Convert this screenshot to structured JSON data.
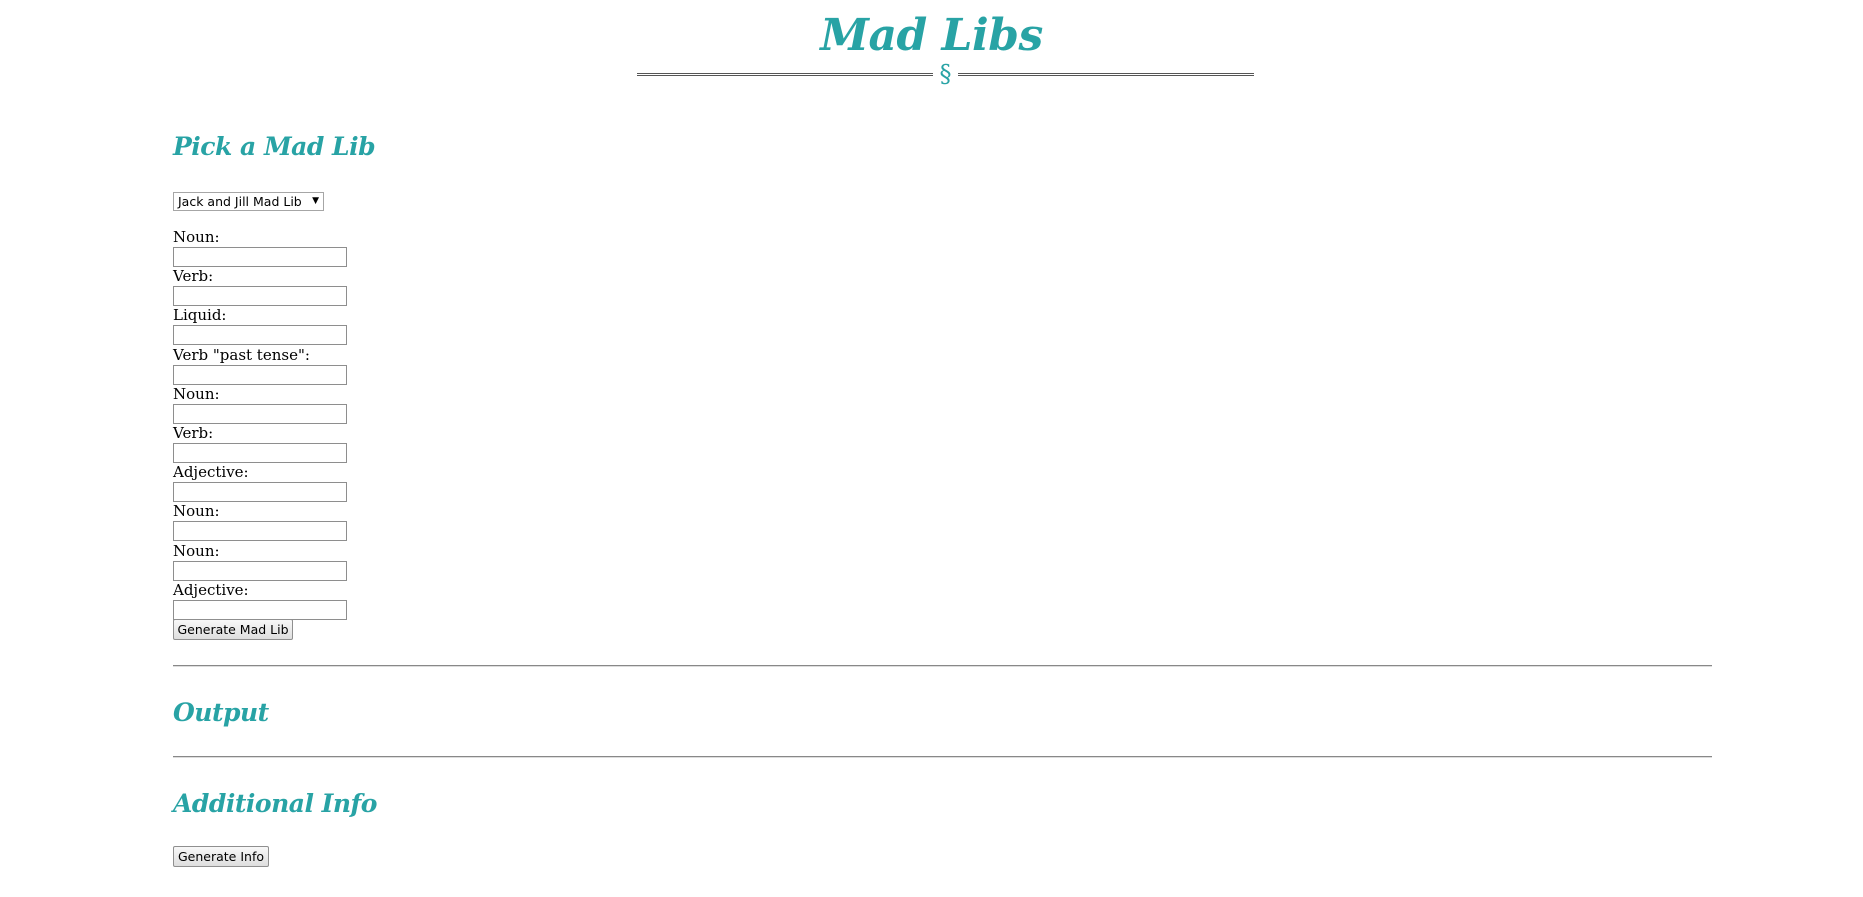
{
  "header": {
    "title": "Mad Libs",
    "ornament": "§"
  },
  "picker": {
    "heading": "Pick a Mad Lib",
    "selected": "Jack and Jill Mad Lib",
    "arrow": "▼"
  },
  "fields": [
    {
      "label": "Noun:",
      "value": ""
    },
    {
      "label": "Verb:",
      "value": ""
    },
    {
      "label": "Liquid:",
      "value": ""
    },
    {
      "label": "Verb \"past tense\":",
      "value": ""
    },
    {
      "label": "Noun:",
      "value": ""
    },
    {
      "label": "Verb:",
      "value": ""
    },
    {
      "label": "Adjective:",
      "value": ""
    },
    {
      "label": "Noun:",
      "value": ""
    },
    {
      "label": "Noun:",
      "value": ""
    },
    {
      "label": "Adjective:",
      "value": ""
    }
  ],
  "generate_button": "Generate Mad Lib",
  "output": {
    "heading": "Output"
  },
  "info": {
    "heading": "Additional Info",
    "button": "Generate Info"
  },
  "colors": {
    "accent": "#28a3a5"
  }
}
